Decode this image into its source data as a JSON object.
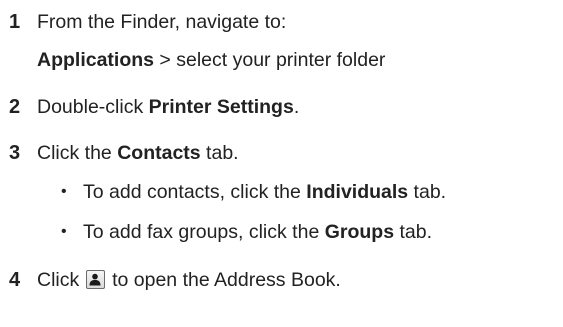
{
  "steps": [
    {
      "number": "1",
      "text": "From the Finder, navigate to:",
      "path_bold": "Applications",
      "path_rest": " > select your printer folder"
    },
    {
      "number": "2",
      "pre": "Double-click ",
      "bold": "Printer Settings",
      "post": "."
    },
    {
      "number": "3",
      "pre": "Click the ",
      "bold": "Contacts",
      "post": " tab.",
      "bullets": [
        {
          "pre": "To add contacts, click the ",
          "bold": "Individuals",
          "post": " tab."
        },
        {
          "pre": "To add fax groups, click the ",
          "bold": "Groups",
          "post": " tab."
        }
      ]
    },
    {
      "number": "4",
      "pre": "Click ",
      "icon": "address-book-icon",
      "post": " to open the Address Book."
    }
  ],
  "bullet_glyph": "•"
}
